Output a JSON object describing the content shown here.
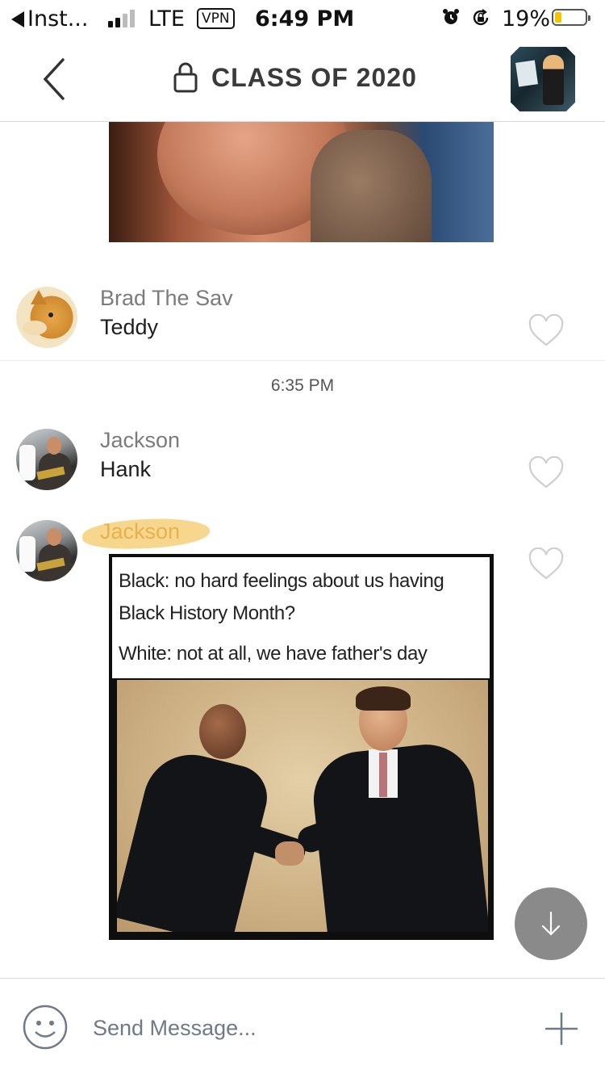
{
  "status_bar": {
    "back_app": "Inst...",
    "network": "LTE",
    "vpn": "VPN",
    "time": "6:49 PM",
    "battery_percent": "19%",
    "battery_level": 0.19,
    "signal_bars": 2,
    "icons": [
      "signal-icon",
      "alarm-icon",
      "rotation-lock-icon",
      "battery-icon"
    ]
  },
  "header": {
    "title": "CLASS OF 2020",
    "icons": [
      "back-chevron-icon",
      "lock-icon",
      "group-avatar"
    ]
  },
  "messages": [
    {
      "sender": "Brad The Sav",
      "text": "Teddy",
      "avatar": "doge-avatar"
    },
    {
      "timestamp": "6:35 PM"
    },
    {
      "sender": "Jackson",
      "text": "Hank",
      "avatar": "jackson-avatar"
    },
    {
      "sender": "Jackson",
      "avatar": "jackson-avatar",
      "image_caption_lines": [
        "Black: no hard feelings about us having",
        "Black History Month?",
        "White: not at all, we have father's day"
      ]
    }
  ],
  "composer": {
    "placeholder": "Send Message...",
    "icons": [
      "emoji-icon",
      "plus-icon"
    ]
  },
  "colors": {
    "accent_text": "#3a3a3a",
    "sender_text": "#7b7b7b",
    "highlight": "#f6d07a",
    "scroll_button": "#8a8a8a",
    "battery_fill": "#f5c400"
  }
}
